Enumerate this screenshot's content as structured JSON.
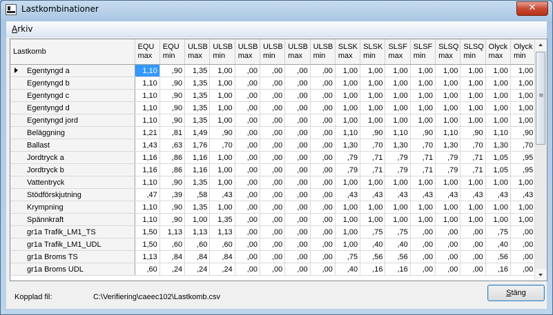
{
  "window": {
    "title": "Lastkombinationer",
    "close_glyph": "✕"
  },
  "menu": {
    "items": [
      {
        "accel": "A",
        "rest": "rkiv"
      }
    ]
  },
  "grid": {
    "row_header_label": "Lastkomb",
    "columns": [
      [
        "EQU",
        "max"
      ],
      [
        "EQU",
        "min"
      ],
      [
        "ULSB",
        "max"
      ],
      [
        "ULSB",
        "min"
      ],
      [
        "ULSB",
        "max"
      ],
      [
        "ULSB",
        "min"
      ],
      [
        "ULSB",
        "max"
      ],
      [
        "ULSB",
        "min"
      ],
      [
        "SLSK",
        "max"
      ],
      [
        "SLSK",
        "min"
      ],
      [
        "SLSF",
        "max"
      ],
      [
        "SLSF",
        "min"
      ],
      [
        "SLSQ",
        "max"
      ],
      [
        "SLSQ",
        "min"
      ],
      [
        "Olyck",
        "max"
      ],
      [
        "Olyck",
        "min"
      ]
    ],
    "rows": [
      {
        "name": "Egentyngd a",
        "values": [
          "1,10",
          ",90",
          "1,35",
          "1,00",
          ",00",
          ",00",
          ",00",
          ",00",
          "1,00",
          "1,00",
          "1,00",
          "1,00",
          "1,00",
          "1,00",
          "1,00",
          "1,00"
        ]
      },
      {
        "name": "Egentyngd b",
        "values": [
          "1,10",
          ",90",
          "1,35",
          "1,00",
          ",00",
          ",00",
          ",00",
          ",00",
          "1,00",
          "1,00",
          "1,00",
          "1,00",
          "1,00",
          "1,00",
          "1,00",
          "1,00"
        ]
      },
      {
        "name": "Egentyngd c",
        "values": [
          "1,10",
          ",90",
          "1,35",
          "1,00",
          ",00",
          ",00",
          ",00",
          ",00",
          "1,00",
          "1,00",
          "1,00",
          "1,00",
          "1,00",
          "1,00",
          "1,00",
          "1,00"
        ]
      },
      {
        "name": "Egentyngd d",
        "values": [
          "1,10",
          ",90",
          "1,35",
          "1,00",
          ",00",
          ",00",
          ",00",
          ",00",
          "1,00",
          "1,00",
          "1,00",
          "1,00",
          "1,00",
          "1,00",
          "1,00",
          "1,00"
        ]
      },
      {
        "name": "Egentyngd jord",
        "values": [
          "1,10",
          ",90",
          "1,35",
          "1,00",
          ",00",
          ",00",
          ",00",
          ",00",
          "1,00",
          "1,00",
          "1,00",
          "1,00",
          "1,00",
          "1,00",
          "1,00",
          "1,00"
        ]
      },
      {
        "name": "Beläggning",
        "values": [
          "1,21",
          ",81",
          "1,49",
          ",90",
          ",00",
          ",00",
          ",00",
          ",00",
          "1,10",
          ",90",
          "1,10",
          ",90",
          "1,10",
          ",90",
          "1,10",
          ",90"
        ]
      },
      {
        "name": "Ballast",
        "values": [
          "1,43",
          ",63",
          "1,76",
          ",70",
          ",00",
          ",00",
          ",00",
          ",00",
          "1,30",
          ",70",
          "1,30",
          ",70",
          "1,30",
          ",70",
          "1,30",
          ",70"
        ]
      },
      {
        "name": "Jordtryck a",
        "values": [
          "1,16",
          ",86",
          "1,16",
          "1,00",
          ",00",
          ",00",
          ",00",
          ",00",
          ",79",
          ",71",
          ",79",
          ",71",
          ",79",
          ",71",
          "1,05",
          ",95"
        ]
      },
      {
        "name": "Jordtryck b",
        "values": [
          "1,16",
          ",86",
          "1,16",
          "1,00",
          ",00",
          ",00",
          ",00",
          ",00",
          ",79",
          ",71",
          ",79",
          ",71",
          ",79",
          ",71",
          "1,05",
          ",95"
        ]
      },
      {
        "name": "Vattentryck",
        "values": [
          "1,10",
          ",90",
          "1,35",
          "1,00",
          ",00",
          ",00",
          ",00",
          ",00",
          "1,00",
          "1,00",
          "1,00",
          "1,00",
          "1,00",
          "1,00",
          "1,00",
          "1,00"
        ]
      },
      {
        "name": "Stödförskjutning",
        "values": [
          ",47",
          ",39",
          ",58",
          ",43",
          ",00",
          ",00",
          ",00",
          ",00",
          ",43",
          ",43",
          ",43",
          ",43",
          ",43",
          ",43",
          ",43",
          ",43"
        ]
      },
      {
        "name": "Krympning",
        "values": [
          "1,10",
          ",90",
          "1,35",
          "1,00",
          ",00",
          ",00",
          ",00",
          ",00",
          "1,00",
          "1,00",
          "1,00",
          "1,00",
          "1,00",
          "1,00",
          "1,00",
          "1,00"
        ]
      },
      {
        "name": "Spännkraft",
        "values": [
          "1,10",
          ",90",
          "1,00",
          "1,35",
          ",00",
          ",00",
          ",00",
          ",00",
          "1,00",
          "1,00",
          "1,00",
          "1,00",
          "1,00",
          "1,00",
          "1,00",
          "1,00"
        ]
      },
      {
        "name": "gr1a Trafik_LM1_TS",
        "values": [
          "1,50",
          "1,13",
          "1,13",
          "1,13",
          ",00",
          ",00",
          ",00",
          ",00",
          "1,00",
          ",75",
          ",75",
          ",00",
          ",00",
          ",00",
          ",75",
          ",00"
        ]
      },
      {
        "name": "gr1a Trafik_LM1_UDL",
        "values": [
          "1,50",
          ",60",
          ",60",
          ",60",
          ",00",
          ",00",
          ",00",
          ",00",
          "1,00",
          ",40",
          ",40",
          ",00",
          ",00",
          ",00",
          ",40",
          ",00"
        ]
      },
      {
        "name": "gr1a Broms TS",
        "values": [
          "1,13",
          ",84",
          ",84",
          ",84",
          ",00",
          ",00",
          ",00",
          ",00",
          ",75",
          ",56",
          ",56",
          ",00",
          ",00",
          ",00",
          ",56",
          ",00"
        ]
      },
      {
        "name": "gr1a Broms UDL",
        "values": [
          ",60",
          ",24",
          ",24",
          ",24",
          ",00",
          ",00",
          ",00",
          ",00",
          ",40",
          ",16",
          ",16",
          ",00",
          ",00",
          ",00",
          ",16",
          ",00"
        ]
      }
    ]
  },
  "footer": {
    "label": "Kopplad fil:",
    "path": "C:\\Verifiering\\caeec102\\Lastkomb.csv",
    "close_accel": "S",
    "close_rest": "täng"
  }
}
